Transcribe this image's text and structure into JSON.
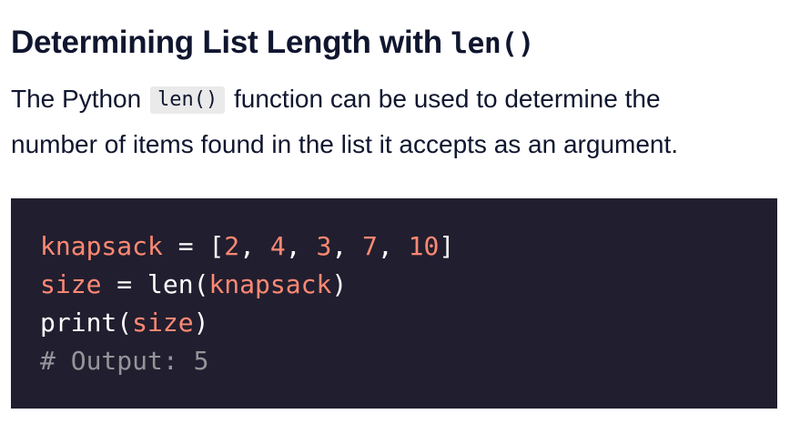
{
  "heading": {
    "text": "Determining List Length with ",
    "code": "len()"
  },
  "description": {
    "before": "The Python ",
    "code": "len()",
    "after": " function can be used to determine the",
    "line2": "number of items found in the list it accepts as an argument."
  },
  "code": {
    "line1": {
      "var": "knapsack",
      "eq": " = ",
      "open": "[",
      "n1": "2",
      "sep1": ", ",
      "n2": "4",
      "sep2": ", ",
      "n3": "3",
      "sep3": ", ",
      "n4": "7",
      "sep4": ", ",
      "n5": "10",
      "close": "]"
    },
    "line2": {
      "var": "size",
      "eq": " = ",
      "fn": "len",
      "open": "(",
      "arg": "knapsack",
      "close": ")"
    },
    "line3": {
      "fn": "print",
      "open": "(",
      "arg": "size",
      "close": ")"
    },
    "line4": {
      "comment": "# Output: 5"
    }
  },
  "colors": {
    "heading_text": "#10162f",
    "code_background": "#211e2f",
    "code_variable": "#ff8973",
    "code_default": "#ffffff",
    "code_comment": "#939598",
    "inline_code_background": "#eaeaea"
  }
}
